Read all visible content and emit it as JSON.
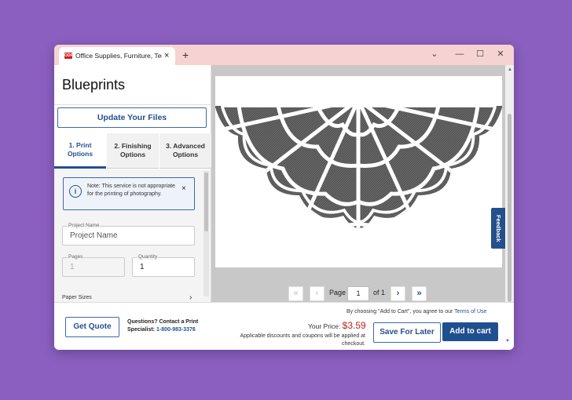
{
  "browser": {
    "tab_title": "Office Supplies, Furniture, Techno",
    "favicon_text": "ODP",
    "new_tab": "+",
    "close_tab": "×",
    "minimize": "⌄",
    "minimize2": "—",
    "maximize": "☐",
    "close": "✕"
  },
  "left": {
    "title": "Blueprints",
    "update_button": "Update Your Files",
    "tabs": [
      {
        "label": "1. Print Options"
      },
      {
        "label": "2. Finishing Options"
      },
      {
        "label": "3. Advanced Options"
      }
    ],
    "note": {
      "icon": "i",
      "text": "Note: This service is not appropriate for the printing of photography.",
      "close": "×"
    },
    "project_name": {
      "label": "Project Name",
      "placeholder": "Project Name"
    },
    "pages": {
      "label": "Pages",
      "value": "1"
    },
    "quantity": {
      "label": "Quantity",
      "value": "1"
    },
    "paper_sizes": "Paper Sizes",
    "paper_chevron": "›"
  },
  "preview": {
    "feedback": "Feedback",
    "pager": {
      "first": "«",
      "prev": "‹",
      "page_label": "Page",
      "page_value": "1",
      "of_label": "of 1",
      "next": "›",
      "last": "»"
    }
  },
  "footer": {
    "quote_button": "Get Quote",
    "contact_line1": "Questions? Contact a Print",
    "contact_line2": "Specialist:",
    "phone": "1-800-983-3376",
    "terms_text": "By choosing \"Add to Cart\", you agree to our",
    "terms_link": "Terms of Use",
    "price_label": "Your Price:",
    "price": "$3.59",
    "discount_note": "Applicable discounts and coupons will be applied at checkout.",
    "save_button": "Save For Later",
    "cart_button": "Add to cart"
  },
  "colors": {
    "accent": "#24508c",
    "price": "#c01f1f",
    "background": "#8a5fbf"
  }
}
